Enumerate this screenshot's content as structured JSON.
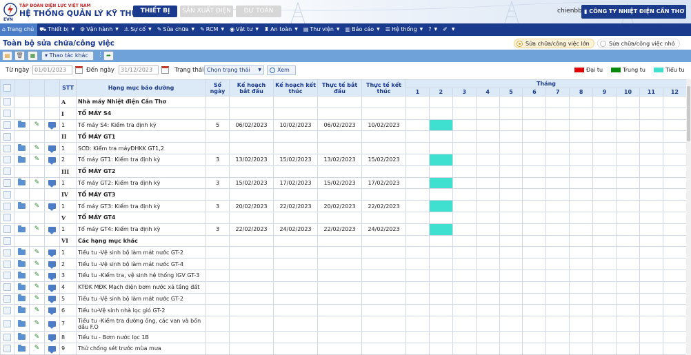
{
  "header": {
    "org_name": "TẬP ĐOÀN ĐIỆN LỰC VIỆT NAM",
    "system_name": "HỆ THỐNG QUẢN LÝ KỸ THUẬT",
    "logo_text": "EVN",
    "tabs": [
      "THIẾT BỊ",
      "SẢN XUẤT ĐIỆN",
      "DỰ TOÁN"
    ],
    "user": "chienbb",
    "company": "CÔNG TY NHIỆT ĐIỆN CẦN THƠ"
  },
  "nav": {
    "items": [
      {
        "label": "Trang chủ",
        "icon": "home-icon"
      },
      {
        "label": "Thiết bị",
        "icon": "car-icon"
      },
      {
        "label": "Vận hành",
        "icon": "cogs-icon"
      },
      {
        "label": "Sự cố",
        "icon": "warning-icon"
      },
      {
        "label": "Sửa chữa",
        "icon": "wrench-icon"
      },
      {
        "label": "RCM",
        "icon": "wrench-icon"
      },
      {
        "label": "Vật tư",
        "icon": "globe-icon"
      },
      {
        "label": "An toàn",
        "icon": "person-icon"
      },
      {
        "label": "Thư viện",
        "icon": "book-icon"
      },
      {
        "label": "Báo cáo",
        "icon": "chart-icon"
      },
      {
        "label": "Hệ thống",
        "icon": "list-icon"
      },
      {
        "label": "?",
        "icon": ""
      },
      {
        "label": "",
        "icon": "brush-icon"
      }
    ]
  },
  "page": {
    "title": "Toàn bộ sửa chữa/công việc",
    "type_major": "Sửa chữa/công việc lớn",
    "type_minor": "Sửa chữa/công việc nhỏ"
  },
  "toolbar": {
    "more_label": "Thao tác khác"
  },
  "filter": {
    "from_label": "Từ ngày",
    "from_value": "01/01/2023",
    "to_label": "Đến ngày",
    "to_value": "31/12/2023",
    "status_label": "Trạng thái",
    "status_value": "Chọn trạng thái",
    "view_label": "Xem"
  },
  "legend": [
    {
      "label": "Đại tu",
      "color": "#e00000"
    },
    {
      "label": "Trung tu",
      "color": "#0a8a0a"
    },
    {
      "label": "Tiểu tu",
      "color": "#40e0d0"
    }
  ],
  "table": {
    "headers": {
      "stt": "STT",
      "item": "Hạng mục bảo dưỡng",
      "days": "Số ngày",
      "plan_start": "Kế hoạch bắt đầu",
      "plan_end": "Kế hoạch kết thúc",
      "actual_start": "Thực tế bắt đầu",
      "actual_end": "Thực tế kết thúc",
      "month": "Tháng",
      "months": [
        "1",
        "2",
        "3",
        "4",
        "5",
        "6",
        "7",
        "8",
        "9",
        "10",
        "11",
        "12"
      ]
    },
    "rows": [
      {
        "kind": "group",
        "icons": false,
        "stt": "A",
        "name": "Nhà máy Nhiệt điện Cần Thơ"
      },
      {
        "kind": "group",
        "icons": false,
        "stt": "I",
        "name": "TỔ MÁY S4"
      },
      {
        "kind": "item",
        "icons": true,
        "stt": "1",
        "name": "Tổ máy S4: Kiểm tra định kỳ",
        "days": "5",
        "plan_start": "06/02/2023",
        "plan_end": "10/02/2023",
        "actual_start": "06/02/2023",
        "actual_end": "10/02/2023",
        "bar_month": 2
      },
      {
        "kind": "group",
        "icons": false,
        "stt": "II",
        "name": "TỔ MÁY GT1"
      },
      {
        "kind": "item",
        "icons": true,
        "stt": "1",
        "name": "SCĐ: Kiểm tra máyĐHKK GT1,2"
      },
      {
        "kind": "item",
        "icons": true,
        "stt": "2",
        "name": "Tổ máy GT1: Kiểm tra định kỳ",
        "days": "3",
        "plan_start": "13/02/2023",
        "plan_end": "15/02/2023",
        "actual_start": "13/02/2023",
        "actual_end": "15/02/2023",
        "bar_month": 2
      },
      {
        "kind": "group",
        "icons": false,
        "stt": "III",
        "name": "TỔ MÁY GT2"
      },
      {
        "kind": "item",
        "icons": true,
        "stt": "1",
        "name": "Tổ máy GT2: Kiểm tra định kỳ",
        "days": "3",
        "plan_start": "15/02/2023",
        "plan_end": "17/02/2023",
        "actual_start": "15/02/2023",
        "actual_end": "17/02/2023",
        "bar_month": 2
      },
      {
        "kind": "group",
        "icons": false,
        "stt": "IV",
        "name": "TỔ MÁY GT3"
      },
      {
        "kind": "item",
        "icons": true,
        "stt": "1",
        "name": "Tổ máy GT3: Kiểm tra định kỳ",
        "days": "3",
        "plan_start": "20/02/2023",
        "plan_end": "22/02/2023",
        "actual_start": "20/02/2023",
        "actual_end": "22/02/2023",
        "bar_month": 2
      },
      {
        "kind": "group",
        "icons": false,
        "stt": "V",
        "name": "TỔ MÁY GT4"
      },
      {
        "kind": "item",
        "icons": true,
        "stt": "1",
        "name": "Tổ máy GT4: Kiểm tra định kỳ",
        "days": "3",
        "plan_start": "22/02/2023",
        "plan_end": "24/02/2023",
        "actual_start": "22/02/2023",
        "actual_end": "24/02/2023",
        "bar_month": 2
      },
      {
        "kind": "group",
        "icons": false,
        "stt": "VI",
        "name": "Các hạng mục khác"
      },
      {
        "kind": "item",
        "icons": true,
        "stt": "1",
        "name": "Tiểu tu -Vệ sinh bộ làm mát nước GT-2"
      },
      {
        "kind": "item",
        "icons": true,
        "stt": "2",
        "name": "Tiểu tu -Vệ sinh bộ làm mát nước GT-4"
      },
      {
        "kind": "item",
        "icons": true,
        "stt": "3",
        "name": "Tiểu tu -Kiểm tra, vệ sinh hệ thống IGV GT-3"
      },
      {
        "kind": "item",
        "icons": true,
        "stt": "4",
        "name": "KTĐK MĐK Mạch điện bơm nước xả tầng đất"
      },
      {
        "kind": "item",
        "icons": true,
        "stt": "5",
        "name": "Tiểu tu -Vệ sinh bộ làm mát nước GT-2"
      },
      {
        "kind": "item",
        "icons": true,
        "stt": "6",
        "name": "Tiểu tu-Vệ sinh nhà lọc gió GT-2"
      },
      {
        "kind": "item",
        "icons": true,
        "stt": "7",
        "name": "Tiểu tu -Kiểm tra đường ống, các van và bồn dầu F.O",
        "tall": true
      },
      {
        "kind": "item",
        "icons": true,
        "stt": "8",
        "name": "Tiểu tu - Bơm nước lọc 1B"
      },
      {
        "kind": "item",
        "icons": true,
        "stt": "9",
        "name": "Thử chống sét trước mùa mưa"
      }
    ]
  }
}
